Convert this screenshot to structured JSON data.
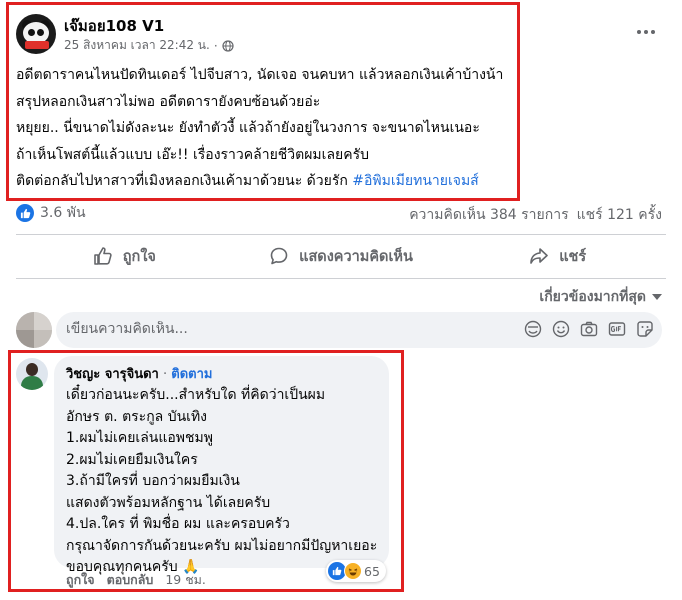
{
  "post": {
    "page_name": "เจ๊มอย108 V1",
    "timestamp": "25 สิงหาคม เวลา 22:42 น.",
    "privacy_icon": "globe-icon",
    "more_icon": "more-horizontal-icon",
    "text_lines": [
      "อดีตดาราคนไหนปัดทินเดอร์ ไปจีบสาว, นัดเจอ จนคบหา แล้วหลอกเงินเค้าบ้างน้า",
      "สรุปหลอกเงินสาวไม่พอ อดีตดารายังคบซ้อนด้วยอ่ะ",
      "หยุยย.. นี่ขนาดไม่ดังละนะ ยังทำตัวงี้ แล้วถ้ายังอยู่ในวงการ จะขนาดไหนเนอะ",
      "ถ้าเห็นโพสต์นี้แล้วแบบ เอ๊ะ!! เรื่องราวคล้ายชีวิตผมเลยครับ",
      "ติดต่อกลับไปหาสาวที่เมิงหลอกเงินเค้ามาด้วยนะ ด้วยรัก"
    ],
    "hashtag": "#อิพิมเมียทนายเจมส์"
  },
  "stats": {
    "reactions": "3.6 พัน",
    "comments": "ความคิดเห็น 384 รายการ",
    "shares": "แชร์ 121 ครั้ง"
  },
  "actions": {
    "like": "ถูกใจ",
    "comment": "แสดงความคิดเห็น",
    "share": "แชร์"
  },
  "sort_label": "เกี่ยวข้องมากที่สุด",
  "composer": {
    "placeholder": "เขียนความคิดเห็น..."
  },
  "comment": {
    "author": "วิชญะ จารุจินดา",
    "separator": "·",
    "follow": "ติดตาม",
    "lines": [
      "เดี๋ยวก่อนนะครับ...สำหรับใด ที่คิดว่าเป็นผม",
      "อักษร ต. ตระกูล บันเทิง",
      "1.ผมไม่เคยเล่นแอพชมพู",
      "2.ผมไม่เคยยืมเงินใคร",
      "3.ถ้ามีใครที่ บอกว่าผมยืมเงิน",
      "แสดงตัวพร้อมหลักฐาน ได้เลยครับ",
      "4.ปล.ใคร ที่ พิมชื่อ ผม และครอบครัว",
      "กรุณาจัดการกันด้วยนะครับ ผมไม่อยากมีปัญหาเยอะ",
      "ขอบคุณทุกคนครับ 🙏"
    ],
    "reaction_count": "65",
    "like_label": "ถูกใจ",
    "reply_label": "ตอบกลับ",
    "time": "19 ชม."
  },
  "colors": {
    "accent": "#1b74e4",
    "link": "#216fdb",
    "highlight_box": "#e02020",
    "secondary_text": "#65676b"
  }
}
